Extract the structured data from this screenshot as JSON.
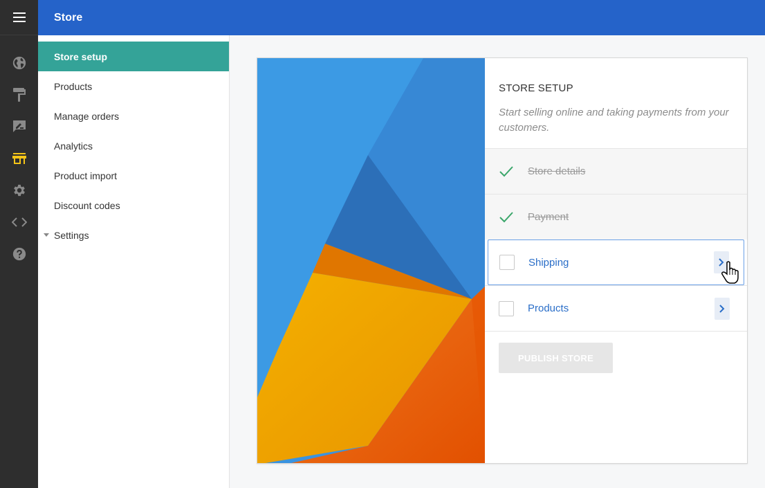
{
  "app": {
    "title": "Store"
  },
  "rail": {
    "icons": [
      "menu-icon",
      "globe-icon",
      "paint-roller-icon",
      "edit-note-icon",
      "store-icon",
      "gear-icon",
      "code-icon",
      "help-icon"
    ],
    "active_index": 4,
    "active_color": "#f5c518"
  },
  "nav": {
    "items": [
      {
        "label": "Store setup",
        "active": true
      },
      {
        "label": "Products"
      },
      {
        "label": "Manage orders"
      },
      {
        "label": "Analytics"
      },
      {
        "label": "Product import"
      },
      {
        "label": "Discount codes"
      },
      {
        "label": "Settings",
        "collapsible": true
      }
    ]
  },
  "card": {
    "heading": "STORE SETUP",
    "description": "Start selling online and taking payments from your customers.",
    "steps": [
      {
        "label": "Store details",
        "completed": true
      },
      {
        "label": "Payment",
        "completed": true
      },
      {
        "label": "Shipping",
        "completed": false,
        "focused": true
      },
      {
        "label": "Products",
        "completed": false
      }
    ],
    "publish_label": "PUBLISH STORE"
  },
  "colors": {
    "topbar": "#2563c9",
    "nav_active": "#34a398",
    "check": "#3aa66a",
    "link": "#2a6ec8"
  }
}
